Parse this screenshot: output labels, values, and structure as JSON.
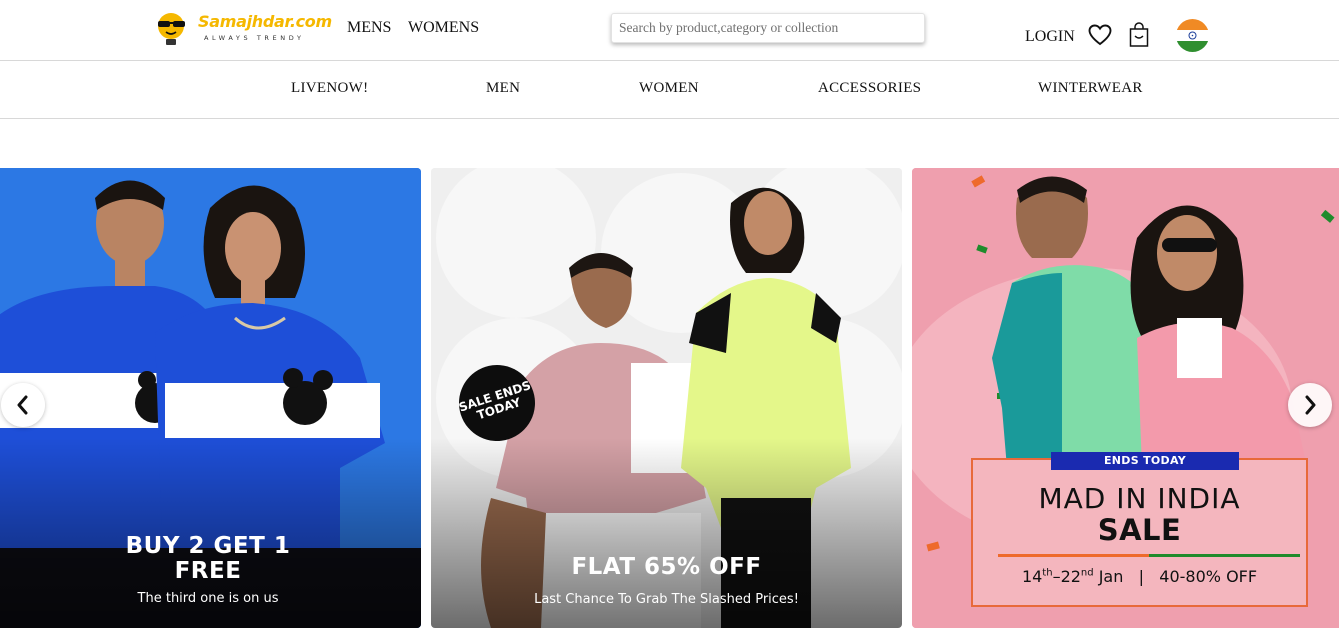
{
  "header": {
    "logo_text": "Samajhdar.com",
    "logo_tagline": "ALWAYS TRENDY",
    "nav": [
      "MENS",
      "WOMENS"
    ],
    "search_placeholder": "Search by product,category or collection",
    "login_label": "LOGIN",
    "icons": [
      "wishlist-heart-icon",
      "shopping-bag-icon",
      "india-flag-icon"
    ]
  },
  "categories": [
    "LIVENOW!",
    "MEN",
    "WOMEN",
    "ACCESSORIES",
    "WINTERWEAR"
  ],
  "carousel": {
    "slides": [
      {
        "headline_line1": "BUY 2 GET 1",
        "headline_line2": "FREE",
        "subtext": "The third one is on us"
      },
      {
        "badge": "SALE ENDS TODAY",
        "headline": "FLAT 65% OFF",
        "subtext": "Last Chance To Grab The Slashed Prices!"
      },
      {
        "ribbon": "ENDS TODAY",
        "title": "MAD IN INDIA",
        "title_sale": "SALE",
        "date_start_day": "14",
        "date_start_suffix": "th",
        "date_end_day": "–22",
        "date_end_suffix": "nd",
        "date_month": " Jan",
        "separator": "|",
        "discount": "40-80% OFF"
      }
    ],
    "prev_icon": "chevron-left-icon",
    "next_icon": "chevron-right-icon"
  },
  "colors": {
    "logo_yellow": "#f5b800",
    "slide1_bg": "#1d6fe0",
    "slide2_bg": "#efefef",
    "slide3_bg": "#ef9fae",
    "ribbon_blue": "#1a2ab0",
    "promo_border": "#e8693a"
  }
}
